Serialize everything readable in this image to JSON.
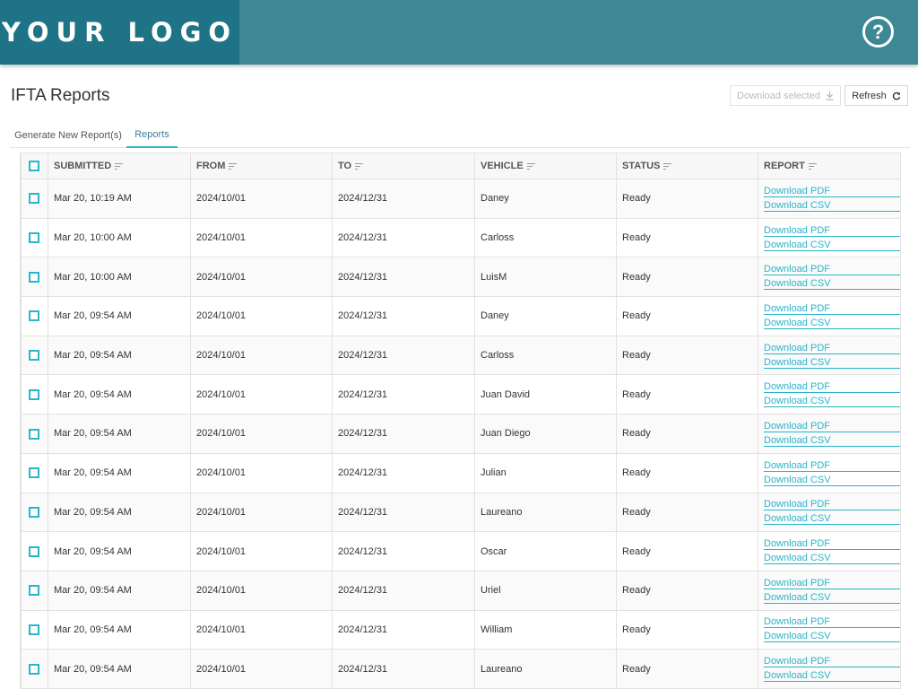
{
  "header": {
    "logo_text": "YOUR LOGO",
    "help_glyph": "?",
    "colors": {
      "bar": "#3e8896",
      "logo_box": "#1e7486",
      "accent": "#2bb8cc"
    }
  },
  "page": {
    "title": "IFTA Reports",
    "download_selected_label": "Download selected",
    "refresh_label": "Refresh"
  },
  "tabs": [
    {
      "label": "Generate New Report(s)",
      "active": false
    },
    {
      "label": "Reports",
      "active": true
    }
  ],
  "table": {
    "columns": [
      "SUBMITTED",
      "FROM",
      "TO",
      "VEHICLE",
      "STATUS",
      "REPORT"
    ],
    "pdf_label": "Download PDF",
    "csv_label": "Download CSV",
    "rows": [
      {
        "submitted": "Mar 20, 10:19 AM",
        "from": "2024/10/01",
        "to": "2024/12/31",
        "vehicle": "Daney",
        "status": "Ready"
      },
      {
        "submitted": "Mar 20, 10:00 AM",
        "from": "2024/10/01",
        "to": "2024/12/31",
        "vehicle": "Carloss",
        "status": "Ready"
      },
      {
        "submitted": "Mar 20, 10:00 AM",
        "from": "2024/10/01",
        "to": "2024/12/31",
        "vehicle": "LuisM",
        "status": "Ready"
      },
      {
        "submitted": "Mar 20, 09:54 AM",
        "from": "2024/10/01",
        "to": "2024/12/31",
        "vehicle": "Daney",
        "status": "Ready"
      },
      {
        "submitted": "Mar 20, 09:54 AM",
        "from": "2024/10/01",
        "to": "2024/12/31",
        "vehicle": "Carloss",
        "status": "Ready"
      },
      {
        "submitted": "Mar 20, 09:54 AM",
        "from": "2024/10/01",
        "to": "2024/12/31",
        "vehicle": "Juan David",
        "status": "Ready"
      },
      {
        "submitted": "Mar 20, 09:54 AM",
        "from": "2024/10/01",
        "to": "2024/12/31",
        "vehicle": "Juan Diego",
        "status": "Ready"
      },
      {
        "submitted": "Mar 20, 09:54 AM",
        "from": "2024/10/01",
        "to": "2024/12/31",
        "vehicle": "Julian",
        "status": "Ready"
      },
      {
        "submitted": "Mar 20, 09:54 AM",
        "from": "2024/10/01",
        "to": "2024/12/31",
        "vehicle": "Laureano",
        "status": "Ready"
      },
      {
        "submitted": "Mar 20, 09:54 AM",
        "from": "2024/10/01",
        "to": "2024/12/31",
        "vehicle": "Oscar",
        "status": "Ready"
      },
      {
        "submitted": "Mar 20, 09:54 AM",
        "from": "2024/10/01",
        "to": "2024/12/31",
        "vehicle": "Uriel",
        "status": "Ready"
      },
      {
        "submitted": "Mar 20, 09:54 AM",
        "from": "2024/10/01",
        "to": "2024/12/31",
        "vehicle": "William",
        "status": "Ready"
      },
      {
        "submitted": "Mar 20, 09:54 AM",
        "from": "2024/10/01",
        "to": "2024/12/31",
        "vehicle": "Laureano",
        "status": "Ready"
      }
    ]
  }
}
